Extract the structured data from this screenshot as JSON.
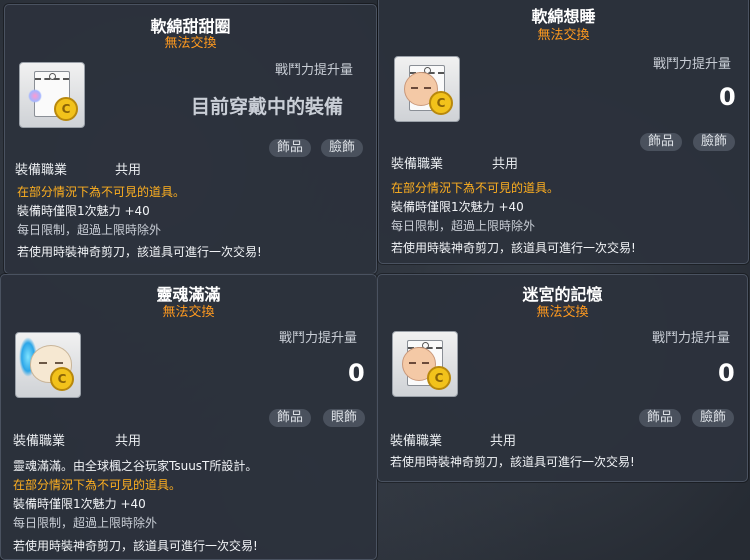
{
  "common": {
    "untradable": "無法交換",
    "power_label": "戰鬥力提升量",
    "job_label": "裝備職業",
    "job_value": "共用",
    "hidden_note": "在部分情況下為不可見的道具。",
    "charm_line": "裝備時僅限1次魅力  +40",
    "daily_limit": "每日限制，超過上限時除外",
    "scissors_note": "若使用時裝神奇剪刀，該道具可進行一次交易!",
    "coin_glyph": "C"
  },
  "cards": [
    {
      "title": "軟綿甜甜圈",
      "equipped_text": "目前穿戴中的裝備",
      "tags": [
        "飾品",
        "臉飾"
      ],
      "icon": "donut-coupon-icon"
    },
    {
      "title": "軟綿想睡",
      "power_value": "0",
      "tags": [
        "飾品",
        "臉飾"
      ],
      "icon": "sleepy-face-coupon-icon"
    },
    {
      "title": "靈魂滿滿",
      "power_value": "0",
      "tags": [
        "飾品",
        "眼飾"
      ],
      "description": "靈魂滿滿。由全球楓之谷玩家TsuusT所設計。",
      "icon": "soul-ghost-icon"
    },
    {
      "title": "迷宮的記憶",
      "power_value": "0",
      "tags": [
        "飾品",
        "臉飾"
      ],
      "icon": "maze-memory-coupon-icon"
    }
  ]
}
